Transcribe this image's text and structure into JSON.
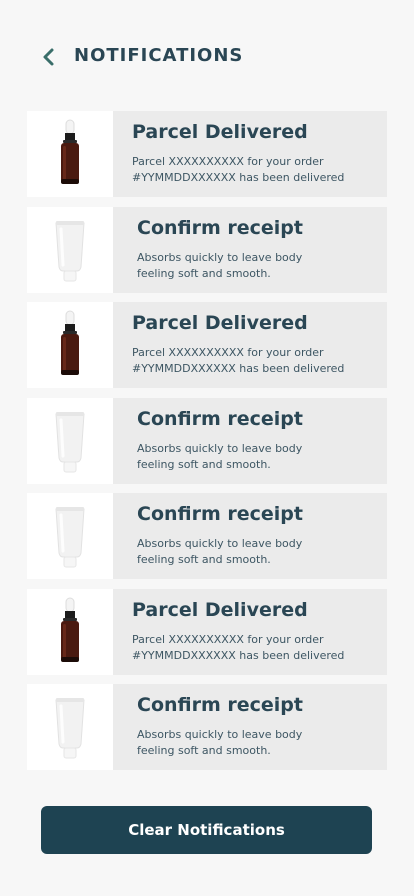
{
  "header": {
    "back_icon": "chevron-left-icon",
    "title": "NOTIFICATIONS"
  },
  "notifications": [
    {
      "type": "parcel",
      "image": "serum-dropper-bottle",
      "title": "Parcel Delivered",
      "description": "Parcel XXXXXXXXXX for your order #YYMMDDXXXXXX has been delivered"
    },
    {
      "type": "receipt",
      "image": "white-cream-tube",
      "title": "Confirm receipt",
      "description": "Absorbs quickly to leave body feeling soft and smooth."
    },
    {
      "type": "parcel",
      "image": "serum-dropper-bottle",
      "title": "Parcel Delivered",
      "description": "Parcel XXXXXXXXXX for your order #YYMMDDXXXXXX has been delivered"
    },
    {
      "type": "receipt",
      "image": "white-cream-tube",
      "title": "Confirm receipt",
      "description": "Absorbs quickly to leave body feeling soft and smooth."
    },
    {
      "type": "receipt",
      "image": "white-cream-tube",
      "title": "Confirm receipt",
      "description": "Absorbs quickly to leave body feeling soft and smooth."
    },
    {
      "type": "parcel",
      "image": "serum-dropper-bottle",
      "title": "Parcel Delivered",
      "description": "Parcel XXXXXXXXXX for your order #YYMMDDXXXXXX has been delivered"
    },
    {
      "type": "receipt",
      "image": "white-cream-tube",
      "title": "Confirm receipt",
      "description": "Absorbs quickly to leave body feeling soft and smooth."
    }
  ],
  "actions": {
    "clear_label": "Clear Notifications"
  },
  "colors": {
    "background": "#f7f7f7",
    "card": "#ebebeb",
    "text_primary": "#2a4654",
    "button": "#1e4352"
  }
}
